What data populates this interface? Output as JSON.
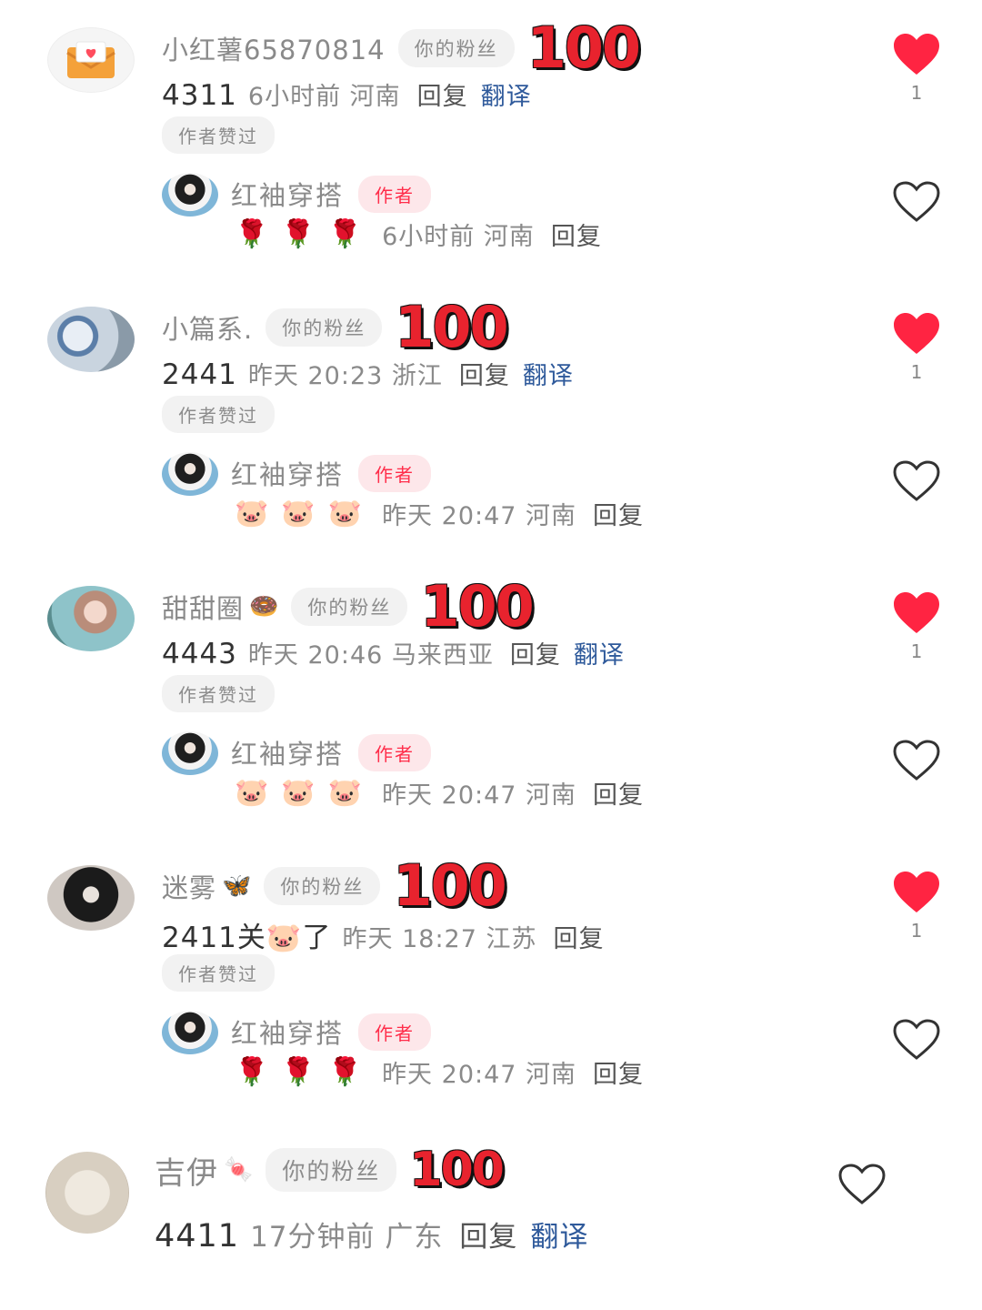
{
  "colors": {
    "accent_red": "#e8232e",
    "translate_blue": "#2f5a9b",
    "author_pink": "#ff2d4a"
  },
  "labels": {
    "fan_badge": "你的粉丝",
    "liked_by_author": "作者赞过",
    "reply": "回复",
    "translate": "翻译",
    "author": "作者"
  },
  "comments": [
    {
      "username": "小红薯65870814",
      "name_emoji": "",
      "score": "100",
      "number": "4311",
      "meta": "6小时前 河南",
      "like_count": "1",
      "liked": true,
      "avatar_icon": "mail-heart-icon",
      "reply": {
        "name": "红袖穿搭",
        "emoji": "🌹🌹🌹",
        "meta": "6小时前 河南"
      }
    },
    {
      "username": "小篇系.",
      "name_emoji": "",
      "score": "100",
      "number": "2441",
      "meta": "昨天 20:23 浙江",
      "like_count": "1",
      "liked": true,
      "reply": {
        "name": "红袖穿搭",
        "emoji": "🐷🐷🐷",
        "meta": "昨天 20:47 河南"
      }
    },
    {
      "username": "甜甜圈",
      "name_emoji": "🍩",
      "score": "100",
      "number": "4443",
      "meta": "昨天 20:46 马来西亚",
      "like_count": "1",
      "liked": true,
      "reply": {
        "name": "红袖穿搭",
        "emoji": "🐷🐷🐷",
        "meta": "昨天 20:47 河南"
      }
    },
    {
      "username": "迷雾",
      "name_emoji": "🦋",
      "score": "100",
      "number": "2411关🐷了",
      "meta": "昨天 18:27 江苏",
      "like_count": "1",
      "liked": true,
      "reply": {
        "name": "红袖穿搭",
        "emoji": "🌹🌹🌹",
        "meta": "昨天 20:47 河南"
      }
    },
    {
      "username": "吉伊",
      "name_emoji": "🍬",
      "score": "100",
      "number": "4411",
      "meta": "17分钟前 广东",
      "like_count": "",
      "liked": false
    }
  ]
}
